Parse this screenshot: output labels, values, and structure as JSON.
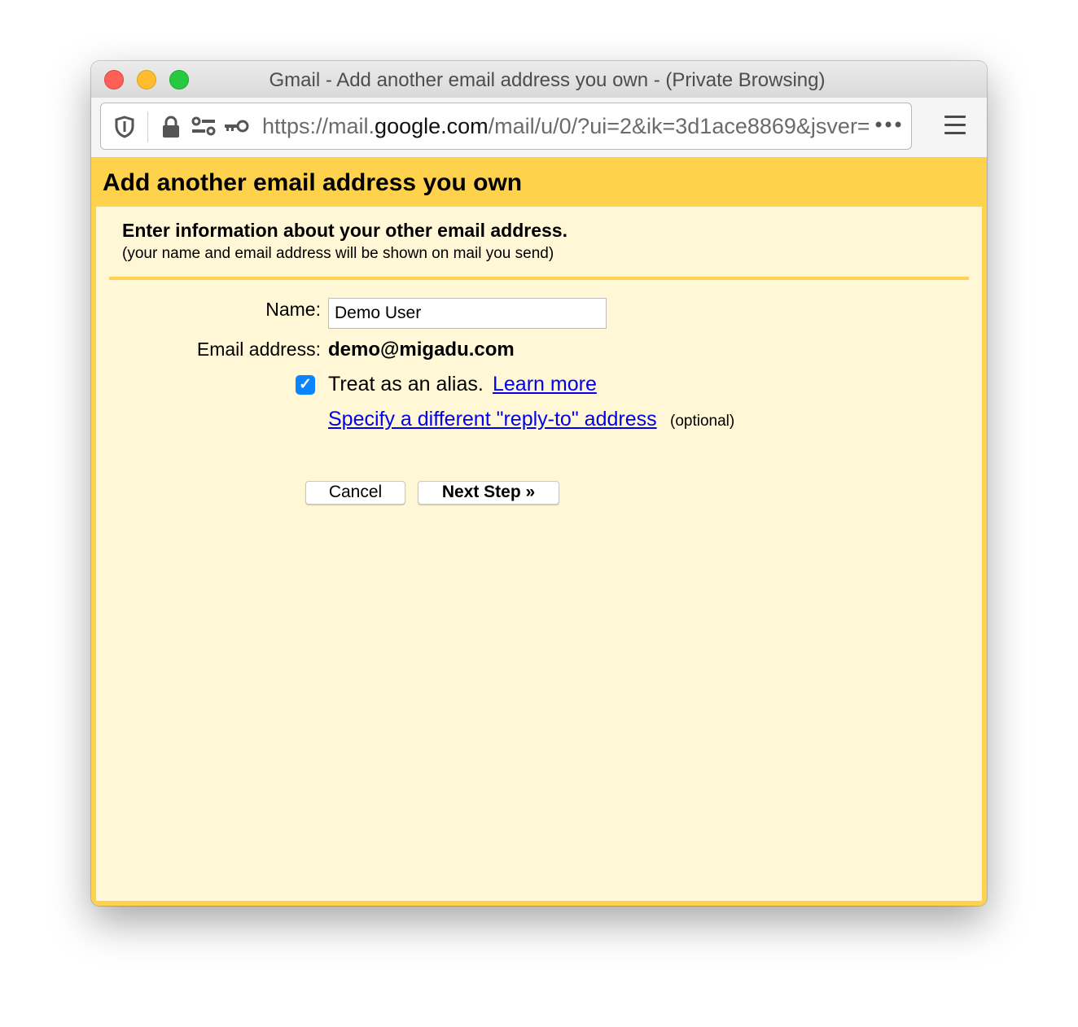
{
  "window": {
    "title": "Gmail - Add another email address you own - (Private Browsing)"
  },
  "toolbar": {
    "url_prefix": "https://mail.",
    "url_domain": "google.com",
    "url_path": "/mail/u/0/?ui=2&ik=3d1ace8869&jsver=",
    "page_actions_icon": "•••",
    "icons": [
      "shield-icon",
      "lock-icon",
      "permissions-icon",
      "key-icon",
      "menu-icon"
    ]
  },
  "dialog": {
    "header_title": "Add another email address you own",
    "intro_title": "Enter information about your other email address.",
    "intro_subtitle": "(your name and email address will be shown on mail you send)",
    "name_label": "Name:",
    "name_value": "Demo User",
    "email_label": "Email address:",
    "email_value": "demo@migadu.com",
    "alias_checked": true,
    "alias_check_glyph": "✓",
    "alias_label": "Treat as an alias.",
    "learn_more_link": "Learn more",
    "reply_to_link": "Specify a different \"reply-to\" address",
    "optional_note": "(optional)",
    "cancel_button": "Cancel",
    "next_button": "Next Step »"
  },
  "colors": {
    "header_yellow": "#ffd24d",
    "panel_background": "#fff7d5",
    "link_blue": "#0000ee",
    "checkbox_blue": "#0a84ff"
  }
}
